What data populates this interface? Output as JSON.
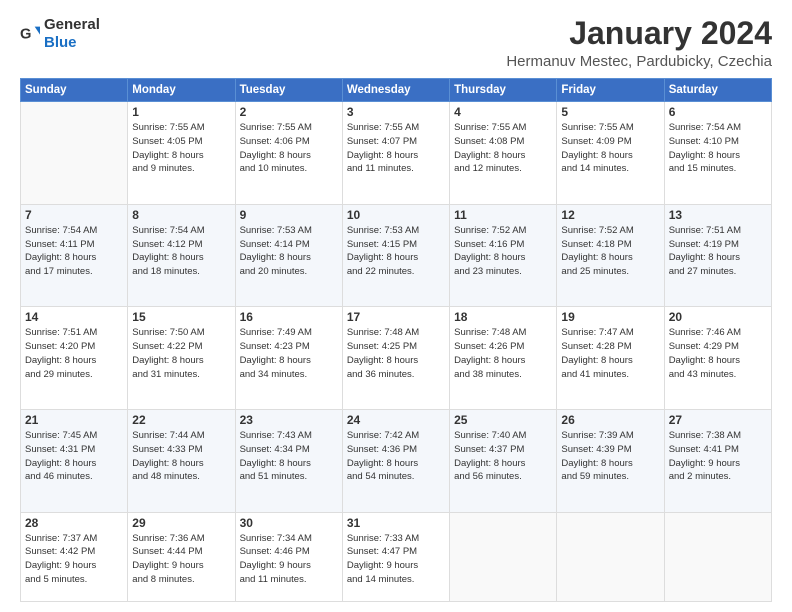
{
  "header": {
    "logo_general": "General",
    "logo_blue": "Blue",
    "month_title": "January 2024",
    "location": "Hermanuv Mestec, Pardubicky, Czechia"
  },
  "weekdays": [
    "Sunday",
    "Monday",
    "Tuesday",
    "Wednesday",
    "Thursday",
    "Friday",
    "Saturday"
  ],
  "weeks": [
    [
      {
        "day": "",
        "info": ""
      },
      {
        "day": "1",
        "info": "Sunrise: 7:55 AM\nSunset: 4:05 PM\nDaylight: 8 hours\nand 9 minutes."
      },
      {
        "day": "2",
        "info": "Sunrise: 7:55 AM\nSunset: 4:06 PM\nDaylight: 8 hours\nand 10 minutes."
      },
      {
        "day": "3",
        "info": "Sunrise: 7:55 AM\nSunset: 4:07 PM\nDaylight: 8 hours\nand 11 minutes."
      },
      {
        "day": "4",
        "info": "Sunrise: 7:55 AM\nSunset: 4:08 PM\nDaylight: 8 hours\nand 12 minutes."
      },
      {
        "day": "5",
        "info": "Sunrise: 7:55 AM\nSunset: 4:09 PM\nDaylight: 8 hours\nand 14 minutes."
      },
      {
        "day": "6",
        "info": "Sunrise: 7:54 AM\nSunset: 4:10 PM\nDaylight: 8 hours\nand 15 minutes."
      }
    ],
    [
      {
        "day": "7",
        "info": "Sunrise: 7:54 AM\nSunset: 4:11 PM\nDaylight: 8 hours\nand 17 minutes."
      },
      {
        "day": "8",
        "info": "Sunrise: 7:54 AM\nSunset: 4:12 PM\nDaylight: 8 hours\nand 18 minutes."
      },
      {
        "day": "9",
        "info": "Sunrise: 7:53 AM\nSunset: 4:14 PM\nDaylight: 8 hours\nand 20 minutes."
      },
      {
        "day": "10",
        "info": "Sunrise: 7:53 AM\nSunset: 4:15 PM\nDaylight: 8 hours\nand 22 minutes."
      },
      {
        "day": "11",
        "info": "Sunrise: 7:52 AM\nSunset: 4:16 PM\nDaylight: 8 hours\nand 23 minutes."
      },
      {
        "day": "12",
        "info": "Sunrise: 7:52 AM\nSunset: 4:18 PM\nDaylight: 8 hours\nand 25 minutes."
      },
      {
        "day": "13",
        "info": "Sunrise: 7:51 AM\nSunset: 4:19 PM\nDaylight: 8 hours\nand 27 minutes."
      }
    ],
    [
      {
        "day": "14",
        "info": "Sunrise: 7:51 AM\nSunset: 4:20 PM\nDaylight: 8 hours\nand 29 minutes."
      },
      {
        "day": "15",
        "info": "Sunrise: 7:50 AM\nSunset: 4:22 PM\nDaylight: 8 hours\nand 31 minutes."
      },
      {
        "day": "16",
        "info": "Sunrise: 7:49 AM\nSunset: 4:23 PM\nDaylight: 8 hours\nand 34 minutes."
      },
      {
        "day": "17",
        "info": "Sunrise: 7:48 AM\nSunset: 4:25 PM\nDaylight: 8 hours\nand 36 minutes."
      },
      {
        "day": "18",
        "info": "Sunrise: 7:48 AM\nSunset: 4:26 PM\nDaylight: 8 hours\nand 38 minutes."
      },
      {
        "day": "19",
        "info": "Sunrise: 7:47 AM\nSunset: 4:28 PM\nDaylight: 8 hours\nand 41 minutes."
      },
      {
        "day": "20",
        "info": "Sunrise: 7:46 AM\nSunset: 4:29 PM\nDaylight: 8 hours\nand 43 minutes."
      }
    ],
    [
      {
        "day": "21",
        "info": "Sunrise: 7:45 AM\nSunset: 4:31 PM\nDaylight: 8 hours\nand 46 minutes."
      },
      {
        "day": "22",
        "info": "Sunrise: 7:44 AM\nSunset: 4:33 PM\nDaylight: 8 hours\nand 48 minutes."
      },
      {
        "day": "23",
        "info": "Sunrise: 7:43 AM\nSunset: 4:34 PM\nDaylight: 8 hours\nand 51 minutes."
      },
      {
        "day": "24",
        "info": "Sunrise: 7:42 AM\nSunset: 4:36 PM\nDaylight: 8 hours\nand 54 minutes."
      },
      {
        "day": "25",
        "info": "Sunrise: 7:40 AM\nSunset: 4:37 PM\nDaylight: 8 hours\nand 56 minutes."
      },
      {
        "day": "26",
        "info": "Sunrise: 7:39 AM\nSunset: 4:39 PM\nDaylight: 8 hours\nand 59 minutes."
      },
      {
        "day": "27",
        "info": "Sunrise: 7:38 AM\nSunset: 4:41 PM\nDaylight: 9 hours\nand 2 minutes."
      }
    ],
    [
      {
        "day": "28",
        "info": "Sunrise: 7:37 AM\nSunset: 4:42 PM\nDaylight: 9 hours\nand 5 minutes."
      },
      {
        "day": "29",
        "info": "Sunrise: 7:36 AM\nSunset: 4:44 PM\nDaylight: 9 hours\nand 8 minutes."
      },
      {
        "day": "30",
        "info": "Sunrise: 7:34 AM\nSunset: 4:46 PM\nDaylight: 9 hours\nand 11 minutes."
      },
      {
        "day": "31",
        "info": "Sunrise: 7:33 AM\nSunset: 4:47 PM\nDaylight: 9 hours\nand 14 minutes."
      },
      {
        "day": "",
        "info": ""
      },
      {
        "day": "",
        "info": ""
      },
      {
        "day": "",
        "info": ""
      }
    ]
  ]
}
